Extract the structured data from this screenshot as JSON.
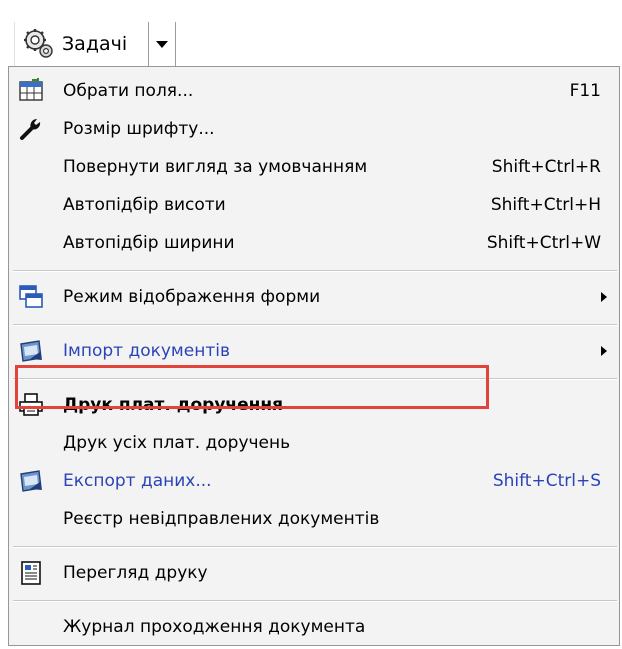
{
  "toolbar": {
    "tasks_label": "Задачі",
    "tasks_icon": "gears-icon",
    "dropdown_icon": "dropdown-arrow-icon"
  },
  "menu": {
    "items": [
      {
        "label": "Обрати поля...",
        "shortcut": "F11",
        "icon": "table-columns-icon"
      },
      {
        "label": "Розмір шрифту...",
        "shortcut": "",
        "icon": "wrench-icon"
      },
      {
        "label": "Повернути вигляд за умовчанням",
        "shortcut": "Shift+Ctrl+R",
        "icon": ""
      },
      {
        "label": "Автопідбір висоти",
        "shortcut": "Shift+Ctrl+H",
        "icon": ""
      },
      {
        "label": "Автопідбір ширини",
        "shortcut": "Shift+Ctrl+W",
        "icon": ""
      },
      {
        "label": "Режим відображення форми",
        "shortcut": "",
        "icon": "windows-icon",
        "submenu": true
      },
      {
        "label": "Імпорт документів",
        "shortcut": "",
        "icon": "import-icon",
        "submenu": true
      },
      {
        "label": "Друк плат. доручення",
        "shortcut": "",
        "icon": "printer-icon",
        "highlighted": true
      },
      {
        "label": "Друк усіх плат. доручень",
        "shortcut": "",
        "icon": ""
      },
      {
        "label": "Експорт даних...",
        "shortcut": "Shift+Ctrl+S",
        "icon": "export-icon"
      },
      {
        "label": "Реєстр невідправлених документів",
        "shortcut": "",
        "icon": ""
      },
      {
        "label": "Перегляд друку",
        "shortcut": "",
        "icon": "print-preview-icon"
      },
      {
        "label": "Журнал проходження документа",
        "shortcut": "",
        "icon": ""
      }
    ]
  },
  "colors": {
    "menu_background": "#f3f3f3",
    "link_blue": "#2a44b8",
    "highlight_border": "#e2443b"
  }
}
